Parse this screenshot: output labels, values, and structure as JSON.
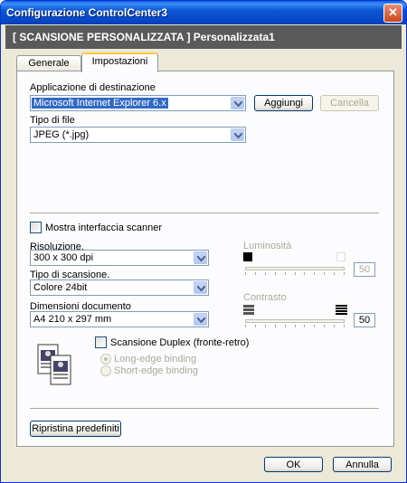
{
  "window": {
    "title": "Configurazione ControlCenter3",
    "close_symbol": "✕"
  },
  "header": {
    "text": "[  SCANSIONE PERSONALIZZATA  ]   Personalizzata1"
  },
  "tabs": [
    {
      "label": "Generale"
    },
    {
      "label": "Impostazioni"
    }
  ],
  "destination": {
    "label": "Applicazione di destinazione",
    "value": "Microsoft Internet Explorer 6.x",
    "add_button": "Aggiungi",
    "cancel_button": "Cancella"
  },
  "file_type": {
    "label": "Tipo di file",
    "value": "JPEG (*.jpg)"
  },
  "scanner_interface": {
    "label": "Mostra interfaccia scanner",
    "checked": false
  },
  "resolution": {
    "label": "Risoluzione.",
    "value": "300 x 300 dpi"
  },
  "scan_type": {
    "label": "Tipo di scansione.",
    "value": "Colore 24bit"
  },
  "doc_size": {
    "label": "Dimensioni documento",
    "value": "A4 210 x 297 mm"
  },
  "brightness": {
    "label": "Luminosità",
    "value": "50",
    "level": 0.5
  },
  "contrast": {
    "label": "Contrasto",
    "value": "50",
    "level": 0.5
  },
  "duplex": {
    "label": "Scansione Duplex (fronte-retro)",
    "checked": false,
    "long_edge": "Long-edge binding",
    "short_edge": "Short-edge binding"
  },
  "restore_button": "Ripristina predefiniti",
  "ok_button": "OK",
  "cancel_button": "Annulla",
  "colors": {
    "titlebar": "#0b57d6",
    "header_band": "#5a5a5a",
    "selection": "#316ac5"
  },
  "icons": [
    "close-icon",
    "dropdown-arrow-icon",
    "duplex-document-icon",
    "black-square-icon",
    "white-square-icon",
    "contrast-low-icon",
    "contrast-high-icon"
  ]
}
